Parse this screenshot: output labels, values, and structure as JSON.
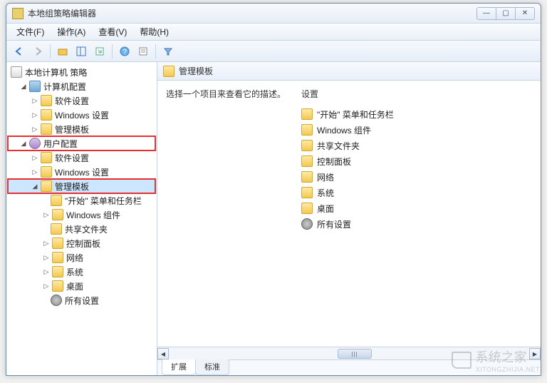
{
  "window": {
    "title": "本地组策略编辑器"
  },
  "menu": {
    "file": "文件(F)",
    "action": "操作(A)",
    "view": "查看(V)",
    "help": "帮助(H)"
  },
  "tree": {
    "root": "本地计算机 策略",
    "comp_config": "计算机配置",
    "software_settings": "软件设置",
    "windows_settings": "Windows 设置",
    "admin_templates": "管理模板",
    "user_config": "用户配置",
    "start_taskbar": "\"开始\" 菜单和任务栏",
    "windows_comp": "Windows 组件",
    "shared_folders": "共享文件夹",
    "control_panel": "控制面板",
    "network": "网络",
    "system": "系统",
    "desktop": "桌面",
    "all_settings": "所有设置"
  },
  "right": {
    "header": "管理模板",
    "desc": "选择一个项目来查看它的描述。",
    "col_setting": "设置",
    "items": {
      "start_taskbar": "\"开始\" 菜单和任务栏",
      "windows_comp": "Windows 组件",
      "shared_folders": "共享文件夹",
      "control_panel": "控制面板",
      "network": "网络",
      "system": "系统",
      "desktop": "桌面",
      "all_settings": "所有设置"
    }
  },
  "tabs": {
    "extended": "扩展",
    "standard": "标准"
  },
  "watermark": {
    "text": "系统之家",
    "url": "XITONGZHIJIA.NET"
  }
}
